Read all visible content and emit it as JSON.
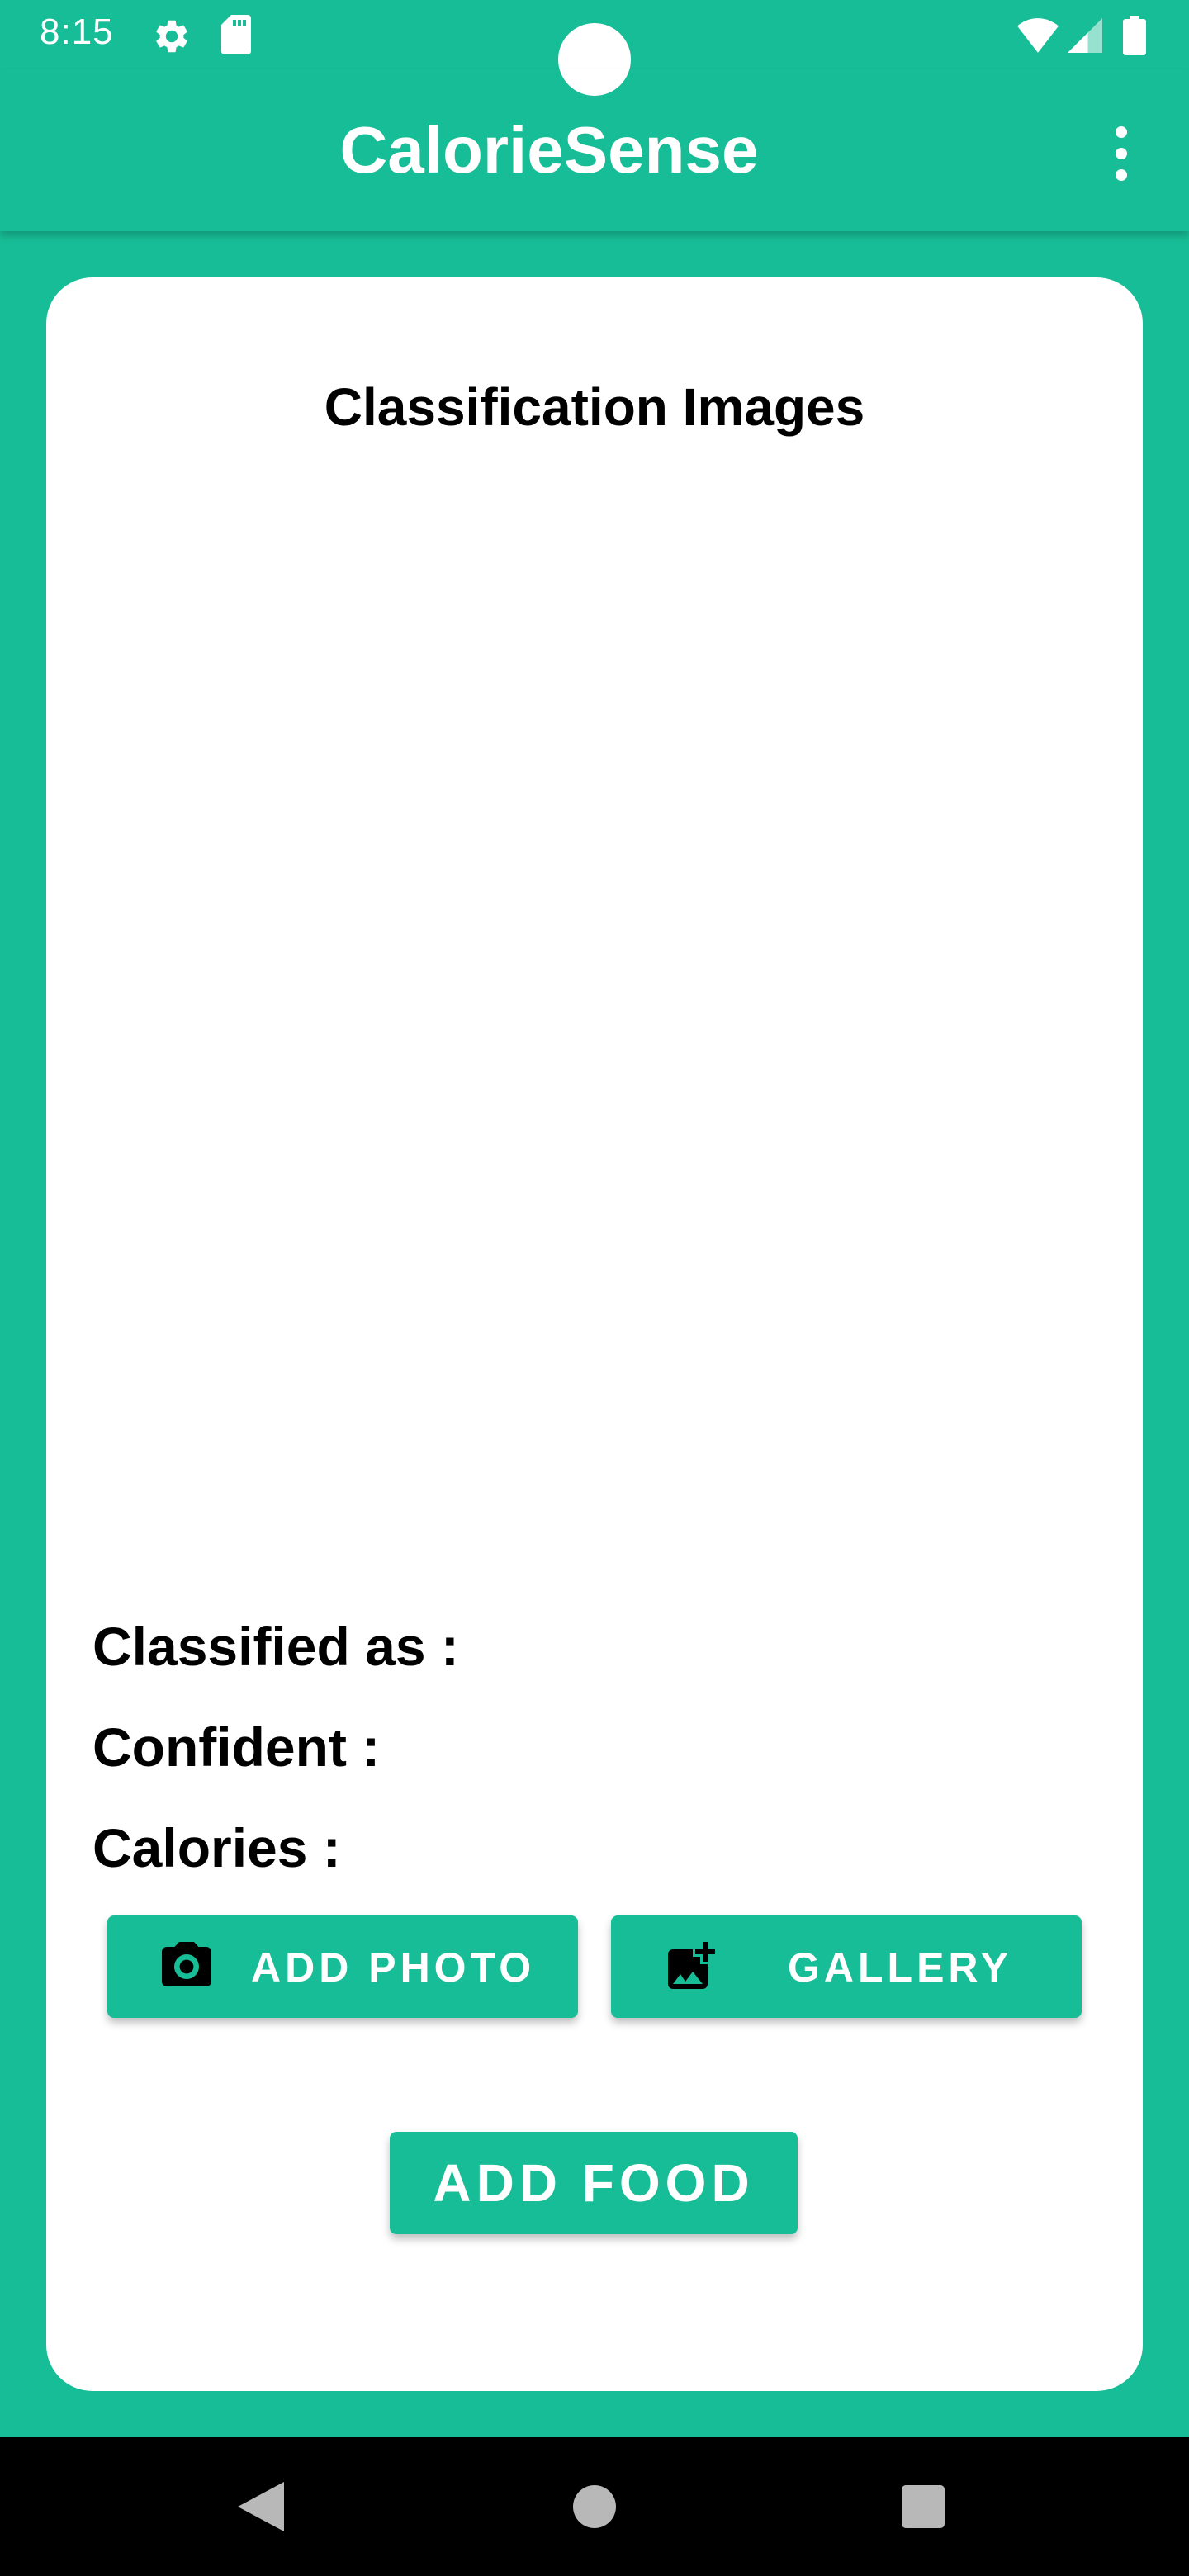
{
  "status_bar": {
    "time": "8:15",
    "icons": [
      "gear-icon",
      "sd-card-icon",
      "wifi-icon",
      "cell-signal-icon",
      "battery-icon"
    ]
  },
  "app_bar": {
    "title": "CalorieSense",
    "menu_icon": "more-vert-icon"
  },
  "card": {
    "title": "Classification Images",
    "classified_label": "Classified as :",
    "confident_label": "Confident :",
    "calories_label": "Calories :"
  },
  "buttons": {
    "add_photo": "ADD PHOTO",
    "gallery": "GALLERY",
    "add_food": "ADD FOOD"
  },
  "nav_bar": {
    "icons": [
      "back-icon",
      "home-icon",
      "recents-icon"
    ]
  },
  "colors": {
    "primary": "#17BD96",
    "card": "#FFFFFF",
    "nav_bar": "#000000"
  }
}
